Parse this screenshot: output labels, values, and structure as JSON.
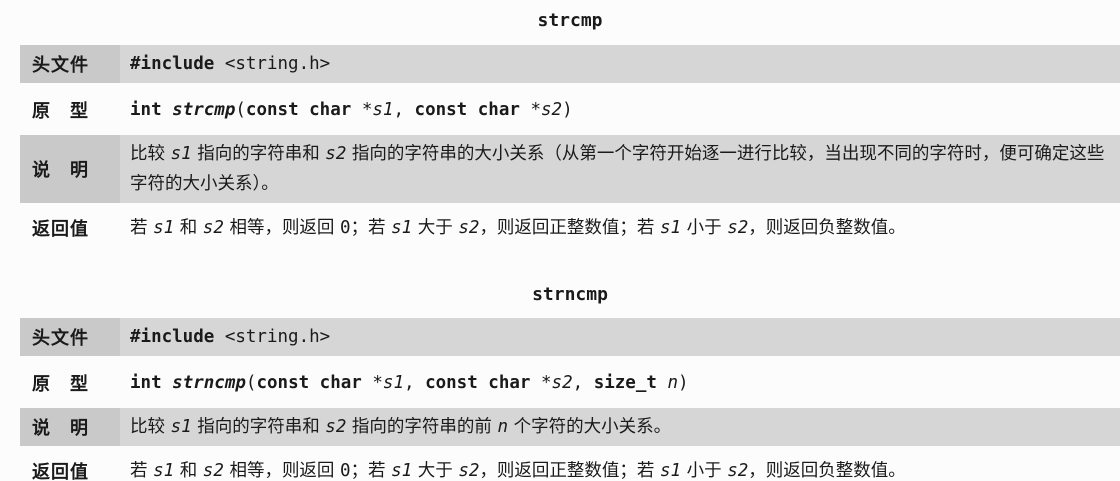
{
  "sections": [
    {
      "title": "strcmp",
      "rows": [
        {
          "label": "头文件",
          "gray": true,
          "segs": [
            {
              "t": "#include ",
              "c": "mono b"
            },
            {
              "t": "<string.h>",
              "c": "mono"
            }
          ]
        },
        {
          "label": "原　型",
          "gray": false,
          "segs": [
            {
              "t": "int ",
              "c": "mono b"
            },
            {
              "t": "strcmp",
              "c": "mono b i"
            },
            {
              "t": "(",
              "c": "mono"
            },
            {
              "t": "const char ",
              "c": "mono b"
            },
            {
              "t": "*",
              "c": "mono"
            },
            {
              "t": "s1",
              "c": "mono i"
            },
            {
              "t": ", ",
              "c": "mono"
            },
            {
              "t": "const char ",
              "c": "mono b"
            },
            {
              "t": "*",
              "c": "mono"
            },
            {
              "t": "s2",
              "c": "mono i"
            },
            {
              "t": ")",
              "c": "mono"
            }
          ]
        },
        {
          "label": "说　明",
          "gray": true,
          "multi": true,
          "segs": [
            {
              "t": "比较 ",
              "c": ""
            },
            {
              "t": "s1",
              "c": "mono i"
            },
            {
              "t": " 指向的字符串和 ",
              "c": ""
            },
            {
              "t": "s2",
              "c": "mono i"
            },
            {
              "t": " 指向的字符串的大小关系（从第一个字符开始逐一进行比较，当出现不同的字符时，便可确定这些字符的大小关系）。",
              "c": ""
            }
          ]
        },
        {
          "label": "返回值",
          "gray": false,
          "segs": [
            {
              "t": "若 ",
              "c": ""
            },
            {
              "t": "s1",
              "c": "mono i"
            },
            {
              "t": " 和 ",
              "c": ""
            },
            {
              "t": "s2",
              "c": "mono i"
            },
            {
              "t": " 相等，则返回 ",
              "c": ""
            },
            {
              "t": "0",
              "c": "mono"
            },
            {
              "t": "；若 ",
              "c": ""
            },
            {
              "t": "s1",
              "c": "mono i"
            },
            {
              "t": " 大于 ",
              "c": ""
            },
            {
              "t": "s2",
              "c": "mono i"
            },
            {
              "t": "，则返回正整数值；若 ",
              "c": ""
            },
            {
              "t": "s1",
              "c": "mono i"
            },
            {
              "t": " 小于 ",
              "c": ""
            },
            {
              "t": "s2",
              "c": "mono i"
            },
            {
              "t": "，则返回负整数值。",
              "c": ""
            }
          ]
        }
      ]
    },
    {
      "title": "strncmp",
      "rows": [
        {
          "label": "头文件",
          "gray": true,
          "segs": [
            {
              "t": "#include ",
              "c": "mono b"
            },
            {
              "t": "<string.h>",
              "c": "mono"
            }
          ]
        },
        {
          "label": "原　型",
          "gray": false,
          "segs": [
            {
              "t": "int ",
              "c": "mono b"
            },
            {
              "t": "strncmp",
              "c": "mono b i"
            },
            {
              "t": "(",
              "c": "mono"
            },
            {
              "t": "const char ",
              "c": "mono b"
            },
            {
              "t": "*",
              "c": "mono"
            },
            {
              "t": "s1",
              "c": "mono i"
            },
            {
              "t": ", ",
              "c": "mono"
            },
            {
              "t": "const char ",
              "c": "mono b"
            },
            {
              "t": "*",
              "c": "mono"
            },
            {
              "t": "s2",
              "c": "mono i"
            },
            {
              "t": ", ",
              "c": "mono"
            },
            {
              "t": "size_t ",
              "c": "mono b"
            },
            {
              "t": "n",
              "c": "mono i"
            },
            {
              "t": ")",
              "c": "mono"
            }
          ]
        },
        {
          "label": "说　明",
          "gray": true,
          "segs": [
            {
              "t": "比较 ",
              "c": ""
            },
            {
              "t": "s1",
              "c": "mono i"
            },
            {
              "t": " 指向的字符串和 ",
              "c": ""
            },
            {
              "t": "s2",
              "c": "mono i"
            },
            {
              "t": " 指向的字符串的前 ",
              "c": ""
            },
            {
              "t": "n",
              "c": "mono i"
            },
            {
              "t": " 个字符的大小关系。",
              "c": ""
            }
          ]
        },
        {
          "label": "返回值",
          "gray": false,
          "segs": [
            {
              "t": "若 ",
              "c": ""
            },
            {
              "t": "s1",
              "c": "mono i"
            },
            {
              "t": " 和 ",
              "c": ""
            },
            {
              "t": "s2",
              "c": "mono i"
            },
            {
              "t": " 相等，则返回 ",
              "c": ""
            },
            {
              "t": "0",
              "c": "mono"
            },
            {
              "t": "；若 ",
              "c": ""
            },
            {
              "t": "s1",
              "c": "mono i"
            },
            {
              "t": " 大于 ",
              "c": ""
            },
            {
              "t": "s2",
              "c": "mono i"
            },
            {
              "t": "，则返回正整数值；若 ",
              "c": ""
            },
            {
              "t": "s1",
              "c": "mono i"
            },
            {
              "t": " 小于 ",
              "c": ""
            },
            {
              "t": "s2",
              "c": "mono i"
            },
            {
              "t": "，则返回负整数值。",
              "c": ""
            }
          ]
        }
      ]
    }
  ]
}
